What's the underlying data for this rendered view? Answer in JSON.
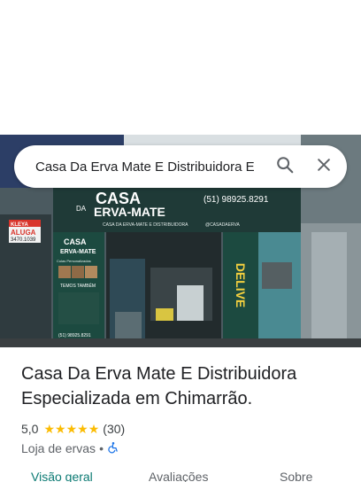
{
  "search": {
    "query": "Casa Da Erva Mate E Distribuidora E"
  },
  "photo": {
    "sign_casa": "CASA",
    "sign_da": "DA",
    "sign_erva": "ERVA-MATE",
    "sign_phone": "(51) 98925.8291",
    "sign_sub": "CASA DA ERVA-MATE E DISTRIBUIDORA",
    "sign_insta": "@CASADAERVA",
    "aluga_label": "ALUGA",
    "kleya_label": "KLEYA",
    "aluga_phone": "3470.1039",
    "banner_casa": "CASA",
    "banner_erva": "ERVA-MATE",
    "banner_cuias": "Cuias Personalizadas",
    "banner_temos": "TEMOS TAMBÉM",
    "banner_phone": "(51) 98925.8291",
    "delivery_text": "DELIVE"
  },
  "place": {
    "title": "Casa Da Erva Mate E Distribuidora Especializada em Chimarrão.",
    "rating": "5,0",
    "stars": 5,
    "review_count": "(30)",
    "category": "Loja de ervas",
    "separator": "•"
  },
  "tabs": [
    {
      "label": "Visão geral",
      "active": true
    },
    {
      "label": "Avaliações",
      "active": false
    },
    {
      "label": "Sobre",
      "active": false
    }
  ],
  "colors": {
    "accent": "#0b7a73",
    "star": "#fbbc04",
    "accessibility": "#1a73e8"
  },
  "icons": {
    "search": "search-icon",
    "close": "close-icon",
    "accessible": "wheelchair-icon",
    "star": "star-icon"
  }
}
